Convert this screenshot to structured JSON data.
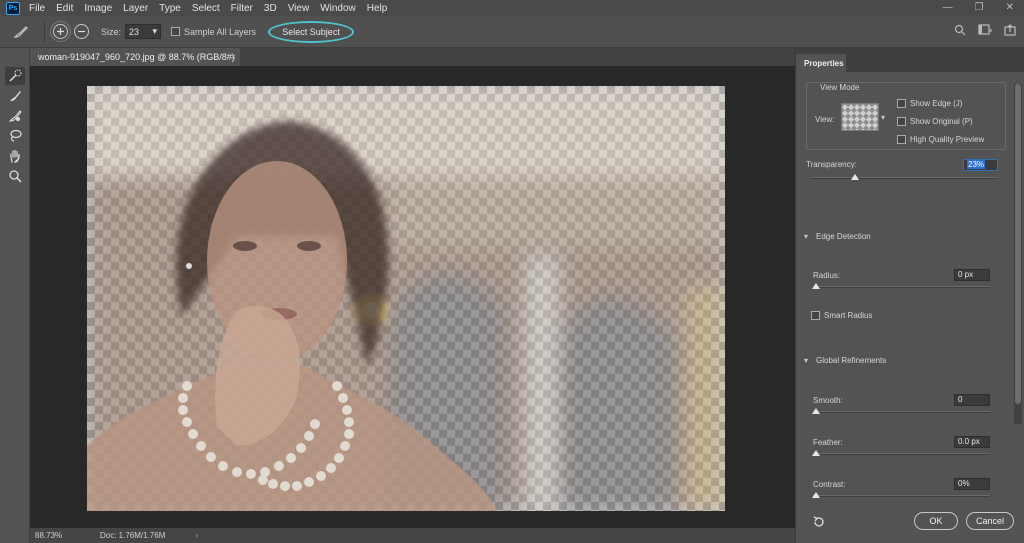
{
  "app": {
    "logo": "Ps"
  },
  "menu": [
    "File",
    "Edit",
    "Image",
    "Layer",
    "Type",
    "Select",
    "Filter",
    "3D",
    "View",
    "Window",
    "Help"
  ],
  "window_controls": [
    "—",
    "❐",
    "✕"
  ],
  "options_bar": {
    "size_label": "Size:",
    "size_value": "23",
    "sample_all_layers": "Sample All Layers",
    "select_subject": "Select Subject"
  },
  "document": {
    "tab_title": "woman-919047_960_720.jpg @ 88.7% (RGB/8#)",
    "close": "×"
  },
  "status": {
    "zoom": "88.73%",
    "doc": "Doc: 1.76M/1.76M",
    "arrow": "›"
  },
  "properties": {
    "tab": "Properties",
    "view_mode_title": "View Mode",
    "view_label": "View:",
    "show_edge": "Show Edge (J)",
    "show_original": "Show Original (P)",
    "high_quality_preview": "High Quality Preview",
    "transparency_label": "Transparency:",
    "transparency_value": "23%",
    "transparency_fraction": 0.23,
    "edge_detection": "Edge Detection",
    "radius_label": "Radius:",
    "radius_value": "0 px",
    "smart_radius": "Smart Radius",
    "global_refinements": "Global Refinements",
    "smooth_label": "Smooth:",
    "smooth_value": "0",
    "feather_label": "Feather:",
    "feather_value": "0.0 px",
    "contrast_label": "Contrast:",
    "contrast_value": "0%",
    "ok": "OK",
    "cancel": "Cancel"
  },
  "colors": {
    "accent_highlight": "#4fc4cf",
    "selection_blue": "#2e6fcf"
  }
}
